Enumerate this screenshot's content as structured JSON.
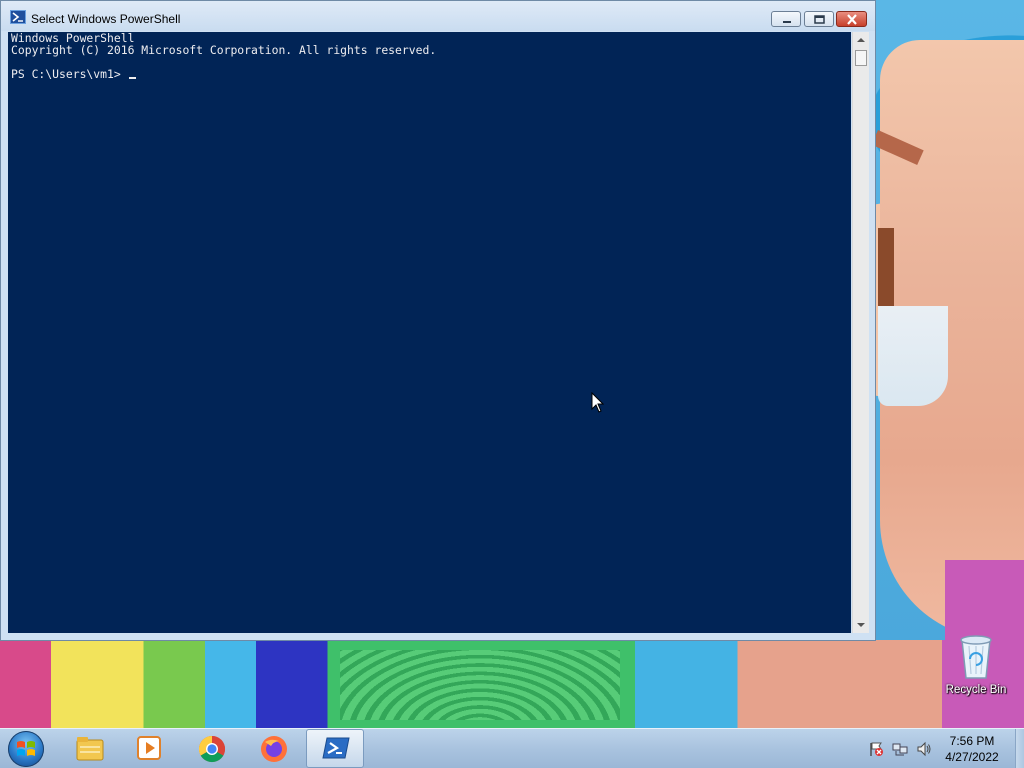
{
  "window": {
    "title": "Select Windows PowerShell",
    "console_lines": [
      "Windows PowerShell",
      "Copyright (C) 2016 Microsoft Corporation. All rights reserved.",
      "",
      "PS C:\\Users\\vm1> "
    ]
  },
  "desktop": {
    "icons": [
      {
        "label": "Recycle Bin",
        "icon": "recycle-bin-icon"
      }
    ]
  },
  "taskbar": {
    "start_icon": "windows-start-icon",
    "pinned": [
      {
        "icon": "file-explorer-icon"
      },
      {
        "icon": "media-player-icon"
      },
      {
        "icon": "chrome-icon"
      },
      {
        "icon": "firefox-icon"
      },
      {
        "icon": "powershell-icon",
        "active": true
      }
    ],
    "tray_icons": [
      "action-center-flag-icon",
      "network-icon",
      "volume-icon"
    ],
    "clock": {
      "time": "7:56 PM",
      "date": "4/27/2022"
    }
  },
  "colors": {
    "console_bg": "#012456",
    "console_fg": "#eeedf0",
    "titlebar": "#cfe1f3",
    "close_button": "#c7402b"
  }
}
